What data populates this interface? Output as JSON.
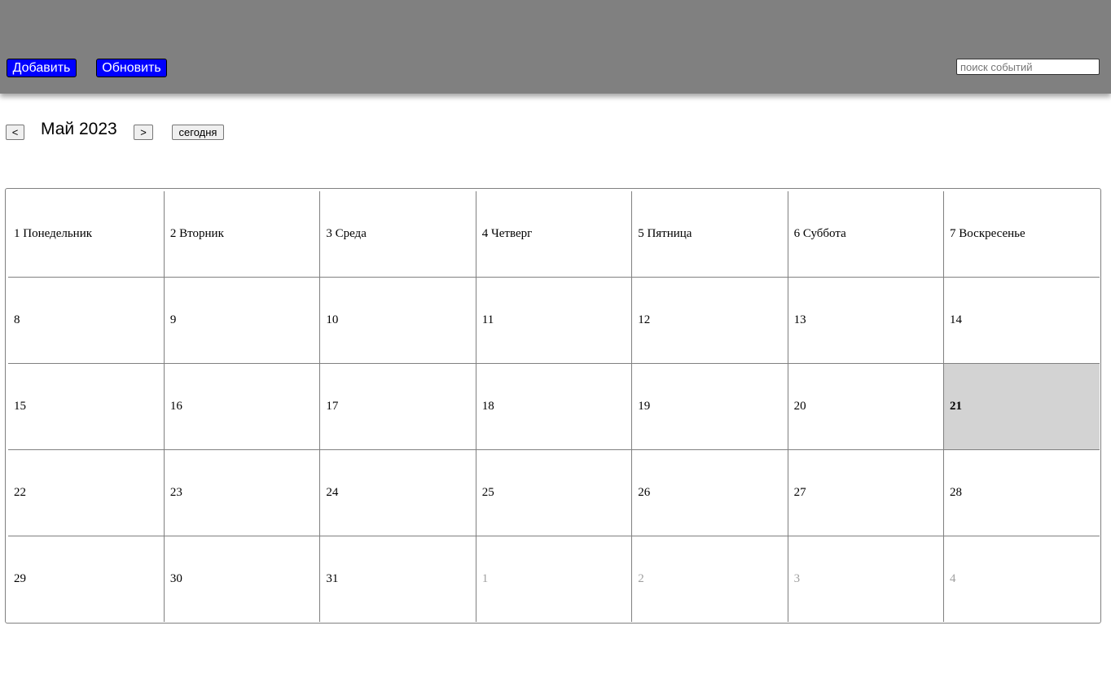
{
  "toolbar": {
    "add_label": "Добавить",
    "refresh_label": "Обновить",
    "search_placeholder": "поиск событий",
    "search_value": ""
  },
  "nav": {
    "prev_label": "<",
    "month_title": "Май 2023",
    "next_label": ">",
    "today_label": "сегодня"
  },
  "colors": {
    "topbar": "#808080",
    "button_bg": "#0000ff",
    "button_text": "#ffffff",
    "today_bg": "#d3d3d3",
    "other_month_text": "#a0a0a0"
  },
  "calendar": {
    "weeks": [
      [
        {
          "label": "1 Понедельник",
          "state": "current"
        },
        {
          "label": "2 Вторник",
          "state": "current"
        },
        {
          "label": "3 Среда",
          "state": "current"
        },
        {
          "label": "4 Четверг",
          "state": "current"
        },
        {
          "label": "5 Пятница",
          "state": "current"
        },
        {
          "label": "6 Суббота",
          "state": "current"
        },
        {
          "label": "7 Воскресенье",
          "state": "current"
        }
      ],
      [
        {
          "label": "8",
          "state": "current"
        },
        {
          "label": "9",
          "state": "current"
        },
        {
          "label": "10",
          "state": "current"
        },
        {
          "label": "11",
          "state": "current"
        },
        {
          "label": "12",
          "state": "current"
        },
        {
          "label": "13",
          "state": "current"
        },
        {
          "label": "14",
          "state": "current"
        }
      ],
      [
        {
          "label": "15",
          "state": "current"
        },
        {
          "label": "16",
          "state": "current"
        },
        {
          "label": "17",
          "state": "current"
        },
        {
          "label": "18",
          "state": "current"
        },
        {
          "label": "19",
          "state": "current"
        },
        {
          "label": "20",
          "state": "current"
        },
        {
          "label": "21",
          "state": "today"
        }
      ],
      [
        {
          "label": "22",
          "state": "current"
        },
        {
          "label": "23",
          "state": "current"
        },
        {
          "label": "24",
          "state": "current"
        },
        {
          "label": "25",
          "state": "current"
        },
        {
          "label": "26",
          "state": "current"
        },
        {
          "label": "27",
          "state": "current"
        },
        {
          "label": "28",
          "state": "current"
        }
      ],
      [
        {
          "label": "29",
          "state": "current"
        },
        {
          "label": "30",
          "state": "current"
        },
        {
          "label": "31",
          "state": "current"
        },
        {
          "label": "1",
          "state": "other"
        },
        {
          "label": "2",
          "state": "other"
        },
        {
          "label": "3",
          "state": "other"
        },
        {
          "label": "4",
          "state": "other"
        }
      ]
    ]
  }
}
